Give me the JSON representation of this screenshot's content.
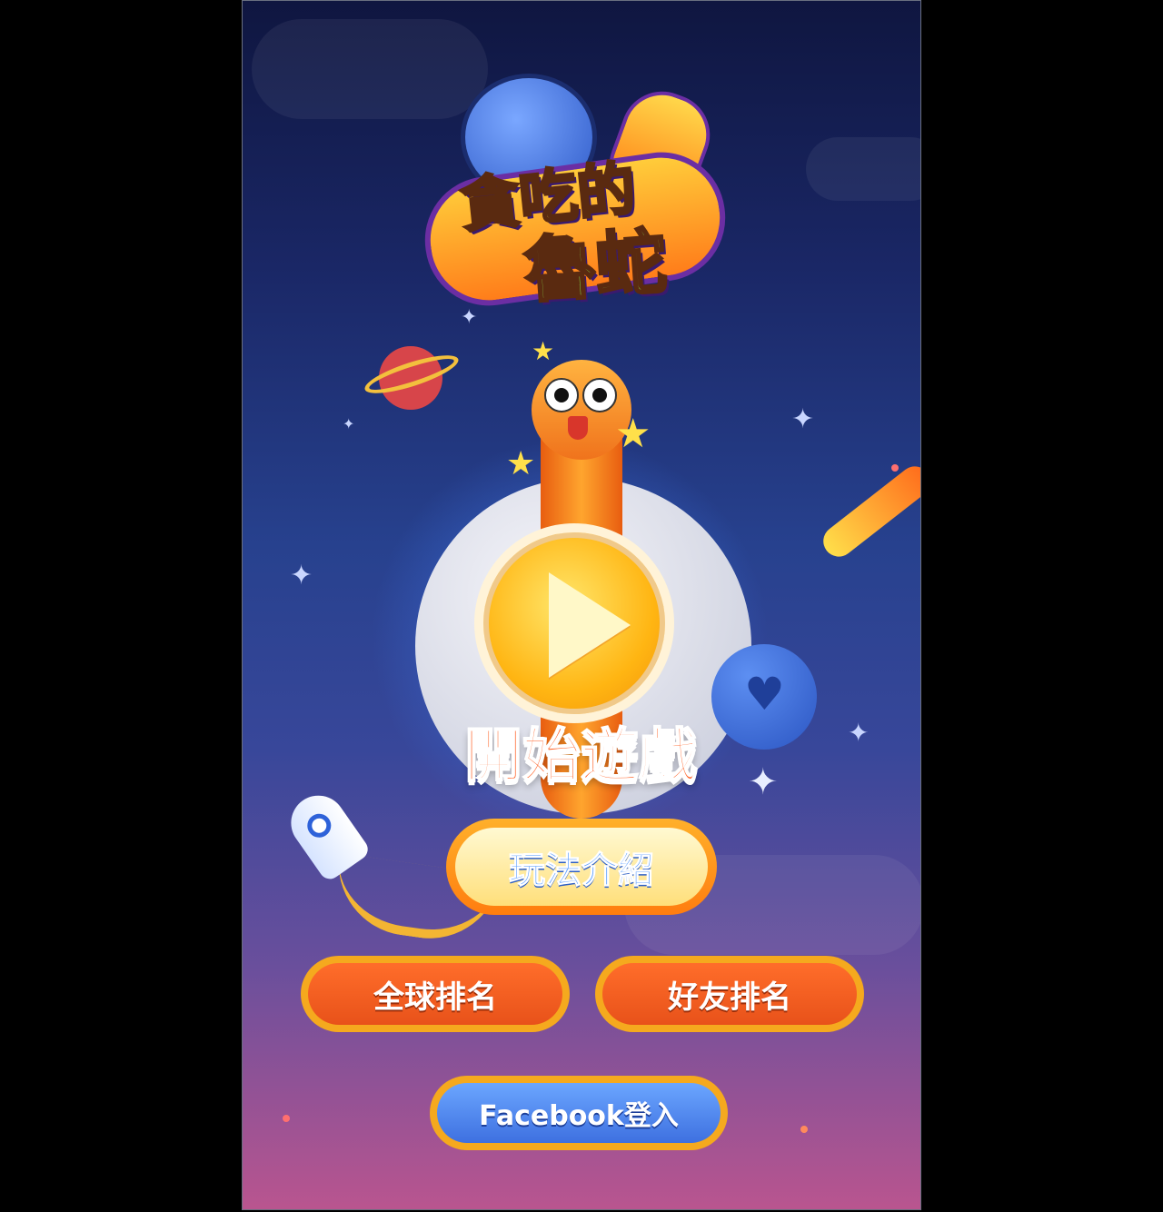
{
  "game": {
    "logo": {
      "line1": "貪吃的",
      "line2": "魯蛇"
    },
    "start_label": "開始遊戲"
  },
  "menu": {
    "howto_label": "玩法介紹",
    "global_rank_label": "全球排名",
    "friend_rank_label": "好友排名",
    "facebook_login_label": "Facebook登入"
  },
  "icons": {
    "play": "play-icon",
    "heart": "heart-icon",
    "star": "star-icon",
    "sparkle": "sparkle-icon"
  },
  "colors": {
    "accent_orange": "#ff7d0f",
    "facebook_blue": "#3e70e0",
    "start_text": "#ff5a1c"
  }
}
